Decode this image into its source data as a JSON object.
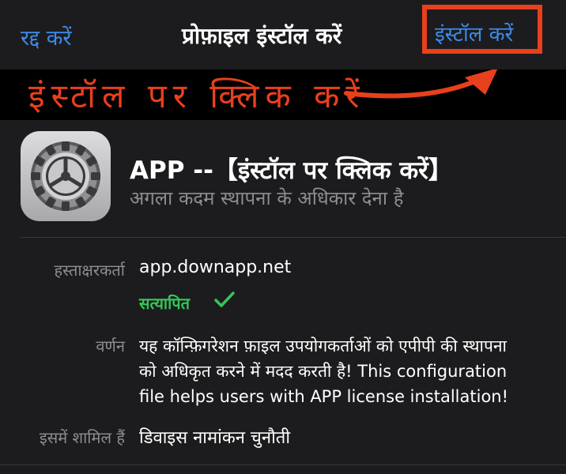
{
  "nav": {
    "cancel_label": "रद्द करें",
    "title": "प्रोफ़ाइल इंस्टॉल करें",
    "install_label": "इंस्टॉल करें"
  },
  "overlay": {
    "instruction": "इंस्टॉल पर क्लिक करें",
    "accent_color": "#e8401c"
  },
  "profile": {
    "icon": "settings-gear-icon",
    "name": "APP --【इंस्टॉल पर क्लिक करें】",
    "subtitle": "अगला कदम स्थापना के अधिकार देना है"
  },
  "details": {
    "signed_by_label": "हस्ताक्षरकर्ता",
    "signed_by_value": "app.downapp.net",
    "verified_label": "सत्यापित",
    "verified_icon": "checkmark-icon",
    "description_label": "वर्णन",
    "description_lines": [
      "यह कॉन्फ़िगरेशन फ़ाइल उपयोगकर्ताओं को एपीपी की स्थापना",
      "को अधिकृत करने में मदद करती है! This configuration",
      "file helps users with APP license installation!"
    ],
    "contains_label": "इसमें शामिल हैं",
    "contains_value": "डिवाइस नामांकन चुनौती"
  },
  "colors": {
    "link_blue": "#3d8ae8",
    "verified_green": "#34c759",
    "background": "#1c1c1e"
  }
}
